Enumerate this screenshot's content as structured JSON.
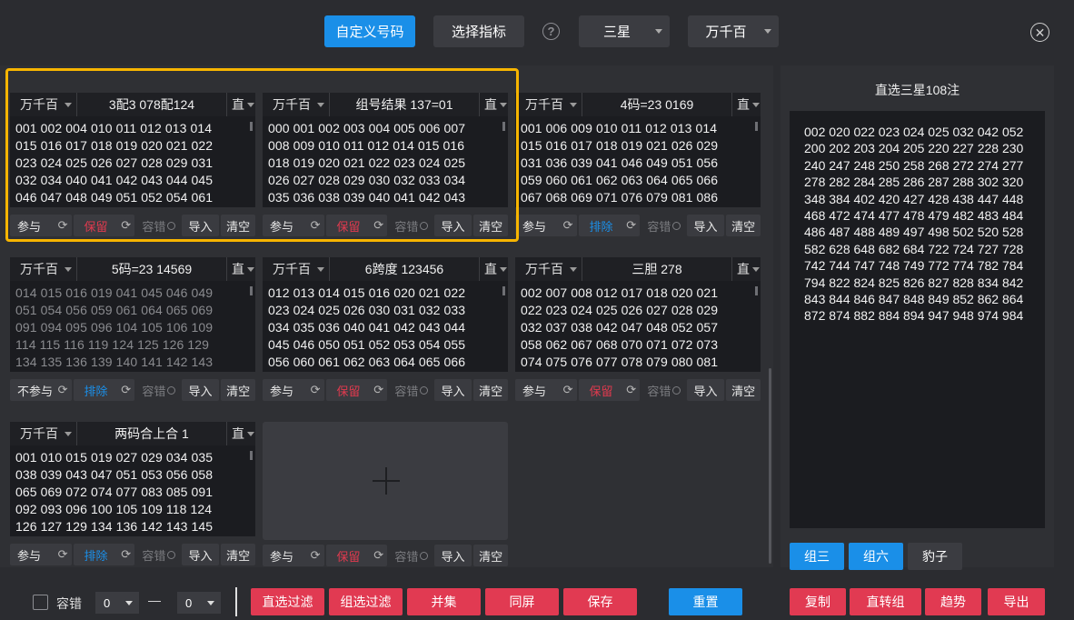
{
  "header": {
    "tab_custom": "自定义号码",
    "tab_select": "选择指标",
    "help": "?",
    "star_select": "三星",
    "position_select": "万千百",
    "close": "✕"
  },
  "cards": [
    {
      "position": "万千百",
      "title": "3配3 078配124",
      "mode": "直",
      "dim": false,
      "numbers": "001 002 004 010 011 012 013 014\n015 016 017 018 019 020 021 022\n023 024 025 026 027 028 029 031\n032 034 040 041 042 043 044 045\n046 047 048 049 051 052 054 061",
      "c1": "参与",
      "c2": "保留",
      "c2type": "keep",
      "c3": "容错",
      "c4": "导入",
      "c5": "清空"
    },
    {
      "position": "万千百",
      "title": "组号结果 137=01",
      "mode": "直",
      "dim": false,
      "numbers": "000 001 002 003 004 005 006 007\n008 009 010 011 012 014 015 016\n018 019 020 021 022 023 024 025\n026 027 028 029 030 032 033 034\n035 036 038 039 040 041 042 043",
      "c1": "参与",
      "c2": "保留",
      "c2type": "keep",
      "c3": "容错",
      "c4": "导入",
      "c5": "清空"
    },
    {
      "position": "万千百",
      "title": "4码=23 0169",
      "mode": "直",
      "dim": false,
      "numbers": "001 006 009 010 011 012 013 014\n015 016 017 018 019 021 026 029\n031 036 039 041 046 049 051 056\n059 060 061 062 063 064 065 066\n067 068 069 071 076 079 081 086",
      "c1": "参与",
      "c2": "排除",
      "c2type": "excl",
      "c3": "容错",
      "c4": "导入",
      "c5": "清空"
    },
    {
      "position": "万千百",
      "title": "5码=23 14569",
      "mode": "直",
      "dim": true,
      "numbers": "014 015 016 019 041 045 046 049\n051 054 056 059 061 064 065 069\n091 094 095 096 104 105 106 109\n114 115 116 119 124 125 126 129\n134 135 136 139 140 141 142 143",
      "c1": "不参与",
      "c2": "排除",
      "c2type": "excl",
      "c3": "容错",
      "c4": "导入",
      "c5": "清空"
    },
    {
      "position": "万千百",
      "title": "6跨度 123456",
      "mode": "直",
      "dim": false,
      "numbers": "012 013 014 015 016 020 021 022\n023 024 025 026 030 031 032 033\n034 035 036 040 041 042 043 044\n045 046 050 051 052 053 054 055\n056 060 061 062 063 064 065 066",
      "c1": "参与",
      "c2": "保留",
      "c2type": "keep",
      "c3": "容错",
      "c4": "导入",
      "c5": "清空"
    },
    {
      "position": "万千百",
      "title": "三胆 278",
      "mode": "直",
      "dim": false,
      "numbers": "002 007 008 012 017 018 020 021\n022 023 024 025 026 027 028 029\n032 037 038 042 047 048 052 057\n058 062 067 068 070 071 072 073\n074 075 076 077 078 079 080 081",
      "c1": "参与",
      "c2": "保留",
      "c2type": "keep",
      "c3": "容错",
      "c4": "导入",
      "c5": "清空"
    },
    {
      "position": "万千百",
      "title": "两码合上合 1",
      "mode": "直",
      "dim": false,
      "numbers": "001 010 015 019 027 029 034 035\n038 039 043 047 051 053 056 058\n065 069 072 074 077 083 085 091\n092 093 096 100 105 109 118 124\n126 127 129 134 136 142 143 145",
      "c1": "参与",
      "c2": "排除",
      "c2type": "excl",
      "c3": "容错",
      "c4": "导入",
      "c5": "清空"
    }
  ],
  "add_card": {
    "c1": "参与",
    "c2": "保留",
    "c3": "容错",
    "c4": "导入",
    "c5": "清空"
  },
  "bottom": {
    "tolerance_label": "容错",
    "min_value": "0",
    "dash": "—",
    "max_value": "0",
    "buttons": [
      "直选过滤",
      "组选过滤",
      "并集",
      "同屏",
      "保存"
    ],
    "reset": "重置"
  },
  "right": {
    "title": "直选三星108注",
    "numbers": "002 020 022 023 024 025 032 042 052\n200 202 203 204 205 220 227 228 230\n240 247 248 250 258 268 272 274 277\n278 282 284 285 286 287 288 302 320\n348 384 402 420 427 428 438 447 448\n468 472 474 477 478 479 482 483 484\n486 487 488 489 497 498 502 520 528\n582 628 648 682 684 722 724 727 728\n742 744 747 748 749 772 774 782 784\n794 822 824 825 826 827 828 834 842\n843 844 846 847 848 849 852 862 864\n872 874 882 884 894 947 948 974 984",
    "tabs": [
      "组三",
      "组六",
      "豹子"
    ],
    "actions": [
      "复制",
      "直转组",
      "趋势",
      "导出"
    ]
  },
  "colors": {
    "accent_blue": "#1a8fe8",
    "accent_red": "#e13a52",
    "highlight_yellow": "#f7b500"
  }
}
